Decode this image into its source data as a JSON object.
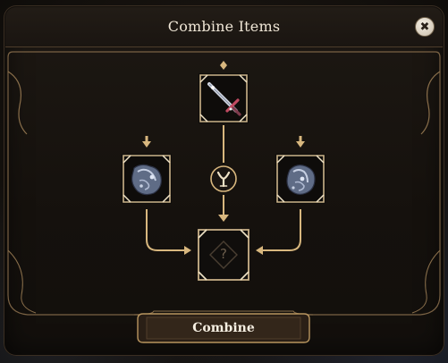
{
  "window": {
    "title": "Combine Items",
    "close_label": "✖"
  },
  "slots": {
    "top": {
      "item": "sword",
      "state": "filled"
    },
    "left": {
      "item": "stone-chunk",
      "state": "filled"
    },
    "right": {
      "item": "stone-chunk",
      "state": "filled"
    },
    "result": {
      "state": "empty",
      "placeholder": "?"
    }
  },
  "center_emblem": "y-rune-icon",
  "actions": {
    "combine_label": "Combine"
  },
  "colors": {
    "gold": "#c8a56e",
    "gold_bright": "#e8cfa0",
    "panel": "#1a1511",
    "text": "#efe6d6"
  }
}
